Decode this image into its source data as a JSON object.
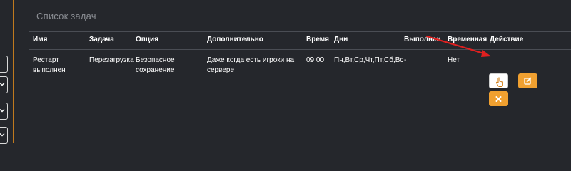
{
  "panel": {
    "title": "Список задач"
  },
  "table": {
    "headers": {
      "name": "Имя",
      "task": "Задача",
      "option": "Опция",
      "extra": "Дополнительно",
      "time": "Время",
      "days": "Дни",
      "done": "Выполнено",
      "temporary": "Временная",
      "action": "Действие"
    },
    "rows": [
      {
        "name": "Рестарт выполнен",
        "task": "Перезагрузка",
        "option": "Безопасное сохранение",
        "extra": "Даже когда есть игроки на сервере",
        "time": "09:00",
        "days": "Пн,Вт,Ср,Чт,Пт,Сб,Вс",
        "done": "-",
        "temporary": "Нет"
      }
    ]
  },
  "colors": {
    "background": "#25272c",
    "accent": "#f0a030",
    "annotation_arrow": "#e02020"
  },
  "icons": {
    "run": "hand-pointer-icon",
    "edit": "edit-icon",
    "delete": "close-icon",
    "select": "chevron-down-icon"
  }
}
